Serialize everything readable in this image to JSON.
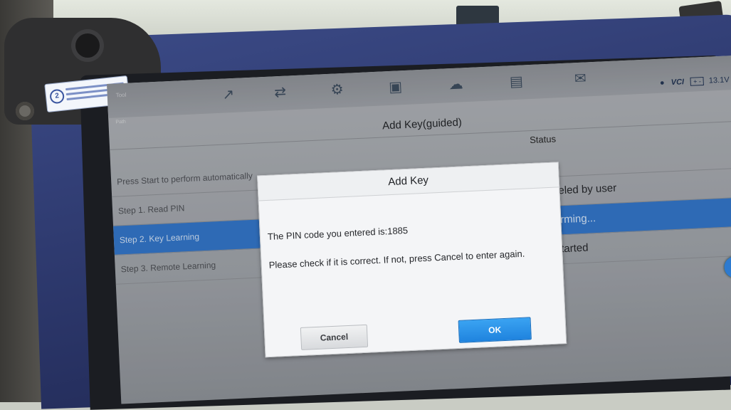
{
  "sticker": {
    "icon": "2"
  },
  "topbar": {
    "brand_small": "Tool",
    "icons": [
      "chart-icon",
      "shuffle-icon",
      "gear-icon",
      "car-icon",
      "cloud-icon",
      "folder-icon",
      "message-icon"
    ],
    "status": {
      "vci": "VCI",
      "voltage": "13.1V"
    }
  },
  "screen": {
    "subbar": "Path",
    "title": "Add Key(guided)",
    "status_header": "Status",
    "rows": [
      {
        "label": "Press Start to perform automatically",
        "status": ""
      },
      {
        "label": "Step 1. Read PIN",
        "status": "Canceled by user"
      },
      {
        "label": "Step 2. Key Learning",
        "status": "Performing..."
      },
      {
        "label": "Step 3. Remote Learning",
        "status": "Not started"
      }
    ],
    "float_button_icon": "chat-icon"
  },
  "dialog": {
    "title": "Add Key",
    "line1": "The PIN code you entered is:1885",
    "line2": "Please check if it is correct. If not, press Cancel to enter again.",
    "cancel_label": "Cancel",
    "ok_label": "OK"
  },
  "colors": {
    "accent": "#2f74c9",
    "ok_button": "#2a8fe8",
    "device_frame": "#2b3669"
  }
}
